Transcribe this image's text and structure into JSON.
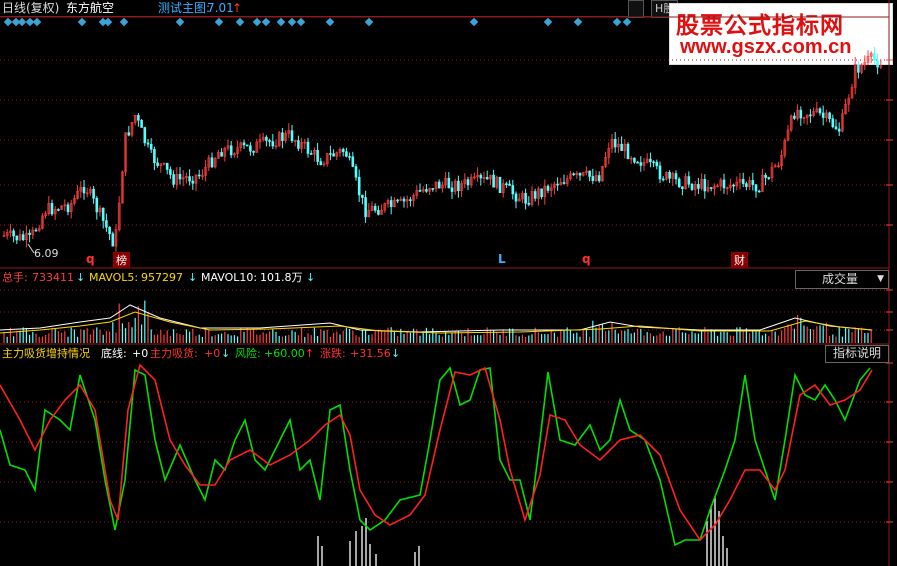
{
  "header": {
    "mode": "日线(复权)",
    "stock_name": "东方航空",
    "main_indicator_label": "测试主图:",
    "main_indicator_value": "7.01",
    "h_label": "H股",
    "icon_tab": "",
    "arrow_up": "↑"
  },
  "watermark": {
    "line1": "股票公式指标网",
    "line2": "www.gszx.com.cn"
  },
  "price_panel": {
    "low_label": "6.09",
    "markers": [
      {
        "text": "q",
        "color": "#ff3030"
      },
      {
        "text": "榜",
        "color": "#ffffff",
        "boxed": true
      },
      {
        "text": "L",
        "color": "#3ab0ff"
      },
      {
        "text": "q",
        "color": "#ff3030"
      },
      {
        "text": "财",
        "color": "#ffffff",
        "boxed": true
      }
    ]
  },
  "volume_panel": {
    "total_label": "总手:",
    "total_value": "733411",
    "mavol5_label": "MAVOL5:",
    "mavol5_value": "957297",
    "mavol10_label": "MAVOL10:",
    "mavol10_value": "101.8万",
    "dropdown": "成交量",
    "arrow_down": "↓"
  },
  "indicator_panel": {
    "title": "主力吸货增持情况",
    "base_label": "底线:",
    "base_value": "+0",
    "absorb_label": "主力吸货:",
    "absorb_value": "+0",
    "risk_label": "风险:",
    "risk_value": "+60.00",
    "change_label": "涨跌:",
    "change_value": "+31.56",
    "explain_button": "指标说明",
    "arrow_up": "↑",
    "arrow_down": "↓"
  },
  "colors": {
    "bg": "#000000",
    "up": "#ff3c3c",
    "down": "#54ffff",
    "grid": "#8b1a1a",
    "green_line": "#00e000",
    "red_line": "#ff2020",
    "diamond": "#3aa6d6",
    "yellow": "#ffd700"
  }
}
